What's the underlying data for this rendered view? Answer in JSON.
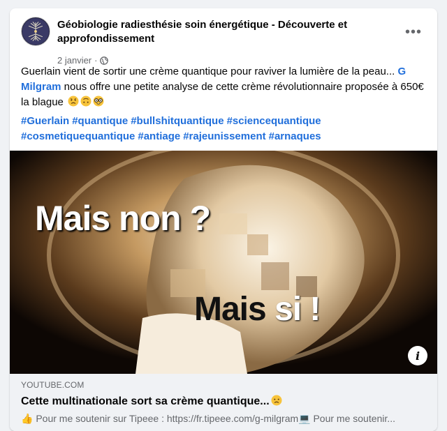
{
  "post": {
    "group_name": "Géobiologie radiesthésie soin énergétique - Découverte et approfondissement",
    "date": "2 janvier",
    "separator": "·",
    "more_label": "•••",
    "text_before_mention": "Guerlain vient de sortir une crème quantique pour raviver la lumière de la peau... ",
    "mention": "G Milgram",
    "text_after_mention": " nous offre une petite analyse de cette crème révolutionnaire proposée à 650€ la blague",
    "emojis": [
      "sad-face-emoji",
      "upside-down-face-emoji",
      "nerd-face-emoji"
    ],
    "hashtags": [
      "#Guerlain",
      "#quantique",
      "#bullshitquantique",
      "#sciencequantique",
      "#cosmetiquequantique",
      "#antiage",
      "#rajeunissement",
      "#arnaques"
    ]
  },
  "media": {
    "caption_top": "Mais non ?",
    "caption_bottom_main": "Mais",
    "caption_bottom_si": "si !",
    "info_label": "i"
  },
  "link": {
    "domain": "YOUTUBE.COM",
    "title": "Cette multinationale sort sa crème quantique...",
    "description": "👍 Pour me soutenir sur Tipeee : https://fr.tipeee.com/g-milgram💻 Pour me soutenir..."
  },
  "colors": {
    "link_blue": "#216fdb",
    "secondary_text": "#65676b",
    "preview_bg": "#f0f2f5"
  }
}
